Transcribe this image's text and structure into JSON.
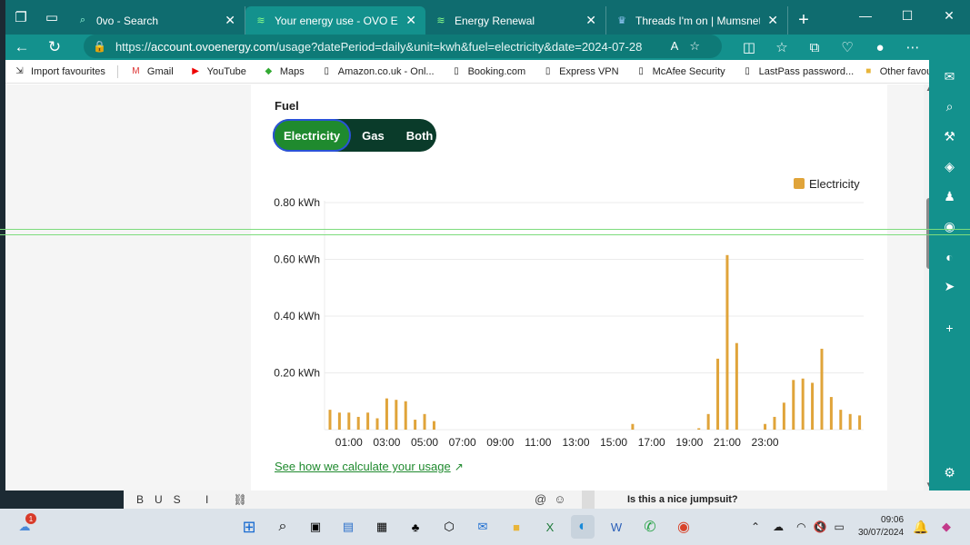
{
  "browser": {
    "tabs": [
      {
        "title": "0vo - Search",
        "icon": "search-icon",
        "active": false
      },
      {
        "title": "Your energy use - OVO Energy",
        "icon": "ovo-icon",
        "active": true
      },
      {
        "title": "Energy Renewal",
        "icon": "ovo-icon",
        "active": false
      },
      {
        "title": "Threads I'm on | Mumsnet",
        "icon": "mumsnet-icon",
        "active": false
      }
    ],
    "url_prefix": "https://",
    "url_host": "account.ovoenergy.com",
    "url_path": "/usage?datePeriod=daily&unit=kwh&fuel=electricity&date=2024-07-28",
    "favourites": [
      {
        "label": "Import favourites",
        "icon": "import-icon"
      },
      {
        "label": "Gmail",
        "icon": "gmail-icon"
      },
      {
        "label": "YouTube",
        "icon": "youtube-icon"
      },
      {
        "label": "Maps",
        "icon": "maps-icon"
      },
      {
        "label": "Amazon.co.uk - Onl...",
        "icon": "page-icon"
      },
      {
        "label": "Booking.com",
        "icon": "page-icon"
      },
      {
        "label": "Express VPN",
        "icon": "page-icon"
      },
      {
        "label": "McAfee Security",
        "icon": "page-icon"
      },
      {
        "label": "LastPass password...",
        "icon": "page-icon"
      }
    ],
    "other_favourites": "Other favourites"
  },
  "page": {
    "fuel_label": "Fuel",
    "fuel_options": [
      "Electricity",
      "Gas",
      "Both"
    ],
    "selected_fuel": "Electricity",
    "link_text": "See how we calculate your usage"
  },
  "chart_data": {
    "type": "bar",
    "legend": "Electricity",
    "color": "#e0a43a",
    "ylim": [
      0,
      0.8
    ],
    "yticks": [
      "0.20 kWh",
      "0.40 kWh",
      "0.60 kWh",
      "0.80 kWh"
    ],
    "xticks": [
      "01:00",
      "03:00",
      "05:00",
      "07:00",
      "09:00",
      "11:00",
      "13:00",
      "15:00",
      "17:00",
      "19:00",
      "21:00",
      "23:00"
    ],
    "interval": "half-hourly",
    "values": [
      0.07,
      0.06,
      0.06,
      0.045,
      0.06,
      0.04,
      0.11,
      0.105,
      0.1,
      0.035,
      0.055,
      0.03,
      0,
      0,
      0,
      0,
      0,
      0,
      0,
      0,
      0,
      0,
      0,
      0,
      0,
      0,
      0,
      0,
      0,
      0,
      0,
      0,
      0.02,
      0,
      0,
      0,
      0,
      0,
      0,
      0.005,
      0.055,
      0.25,
      0.615,
      0.305,
      0,
      0,
      0.02,
      0.045,
      0.095,
      0.175,
      0.18,
      0.165,
      0.285,
      0.115,
      0.07,
      0.055,
      0.05
    ]
  },
  "behind": {
    "question": "Is this a nice jumpsuit?"
  },
  "taskbar": {
    "time": "09:06",
    "date": "30/07/2024",
    "notification_count": "1"
  }
}
